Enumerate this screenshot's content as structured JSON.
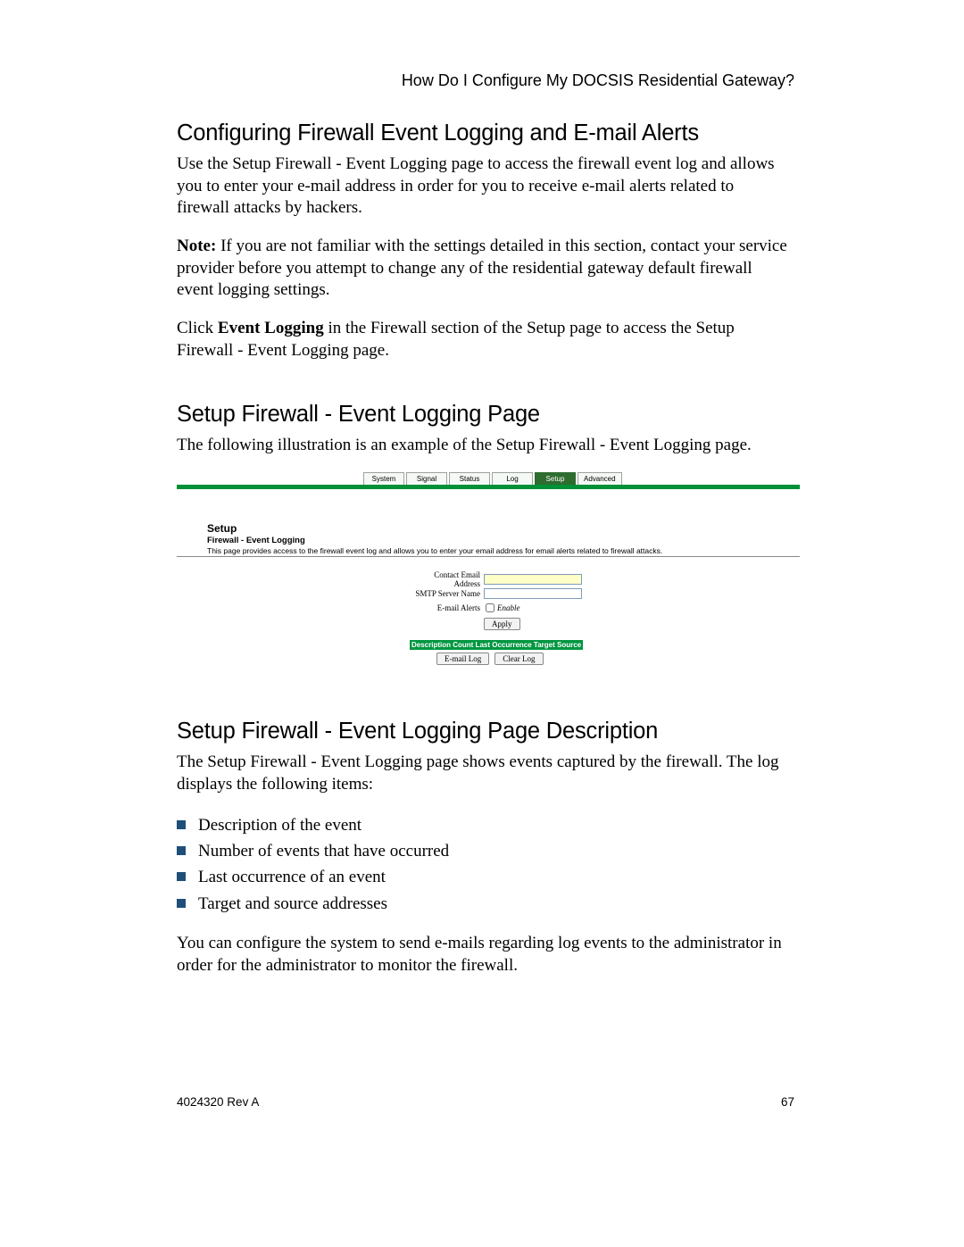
{
  "header_right": "How Do I Configure My DOCSIS Residential Gateway?",
  "section1": {
    "title": "Configuring Firewall Event Logging and E-mail Alerts",
    "p1": "Use the Setup Firewall - Event Logging page to access the firewall event log and allows you to enter your e-mail address in order for you to receive e-mail alerts related to firewall attacks by hackers.",
    "note_label": "Note:",
    "note_text": " If you are not familiar with the settings detailed in this section, contact your service provider before you attempt to change any of the residential gateway default firewall event logging settings.",
    "p2_pre": "Click ",
    "p2_bold": "Event Logging",
    "p2_post": " in the Firewall section of the Setup page to access the Setup Firewall - Event Logging page."
  },
  "section2": {
    "title": "Setup Firewall - Event Logging Page",
    "p1": "The following illustration is an example of the Setup Firewall - Event Logging page."
  },
  "ui": {
    "tabs": [
      "System",
      "Signal",
      "Status",
      "Log",
      "Setup",
      "Advanced"
    ],
    "active_tab": "Setup",
    "setup_title": "Setup",
    "setup_sub": "Firewall - Event Logging",
    "setup_desc": "This page provides access to the firewall event log and allows you to enter your email address for email alerts related to firewall attacks.",
    "lbl_email": "Contact Email Address",
    "lbl_smtp": "SMTP Server Name",
    "lbl_alerts": "E-mail Alerts",
    "enable": "Enable",
    "apply": "Apply",
    "log_header": "Description  Count  Last Occurrence  Target  Source",
    "btn_email_log": "E-mail Log",
    "btn_clear_log": "Clear Log"
  },
  "section3": {
    "title": "Setup Firewall - Event Logging Page Description",
    "p1": "The Setup Firewall - Event Logging page shows events captured by the firewall. The log displays the following items:",
    "items": [
      "Description of the event",
      "Number of events that have occurred",
      "Last occurrence of an event",
      "Target and source addresses"
    ],
    "p2": "You can configure the system to send e-mails regarding log events to the administrator in order for the administrator to monitor the firewall."
  },
  "footer": {
    "left": "4024320 Rev A",
    "right": "67"
  }
}
